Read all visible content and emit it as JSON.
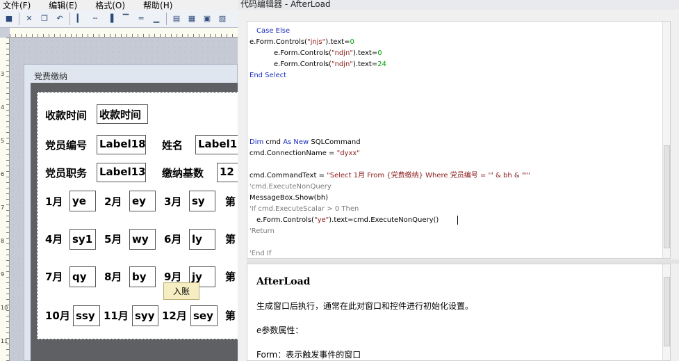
{
  "designer": {
    "menu": [
      "文件(F)",
      "编辑(E)",
      "格式(O)",
      "帮助(H)"
    ],
    "vruler_numbers": [
      "3",
      "4",
      "5",
      "6",
      "7",
      "8",
      "9",
      "10",
      "11"
    ],
    "form_title": "党费缴纳",
    "labels": {
      "time": "收款时间",
      "number": "党员编号",
      "name": "姓名",
      "duty": "党员职务",
      "base": "缴纳基数"
    },
    "fields": {
      "time": "收款时间",
      "number": "Label18",
      "name": "Label1",
      "duty": "Label13",
      "base": "12"
    },
    "months": [
      {
        "label": "1月",
        "value": "ye"
      },
      {
        "label": "2月",
        "value": "ey"
      },
      {
        "label": "3月",
        "value": "sy"
      },
      {
        "label": "4月",
        "value": "sy1"
      },
      {
        "label": "5月",
        "value": "wy"
      },
      {
        "label": "6月",
        "value": "ly"
      },
      {
        "label": "7月",
        "value": "qy"
      },
      {
        "label": "8月",
        "value": "by"
      },
      {
        "label": "9月",
        "value": "jy"
      },
      {
        "label": "10月",
        "value": "ssy"
      },
      {
        "label": "11月",
        "value": "syy"
      },
      {
        "label": "12月",
        "value": "sey"
      }
    ],
    "cut_label": "第",
    "ruzhang": "入账"
  },
  "editor": {
    "title": "代码编辑器 - AfterLoad",
    "help": {
      "title": "AfterLoad",
      "line1": "生成窗口后执行，通常在此对窗口和控件进行初始化设置。",
      "line2": "e参数属性：",
      "line3": "Form：表示触发事件的窗口"
    }
  }
}
